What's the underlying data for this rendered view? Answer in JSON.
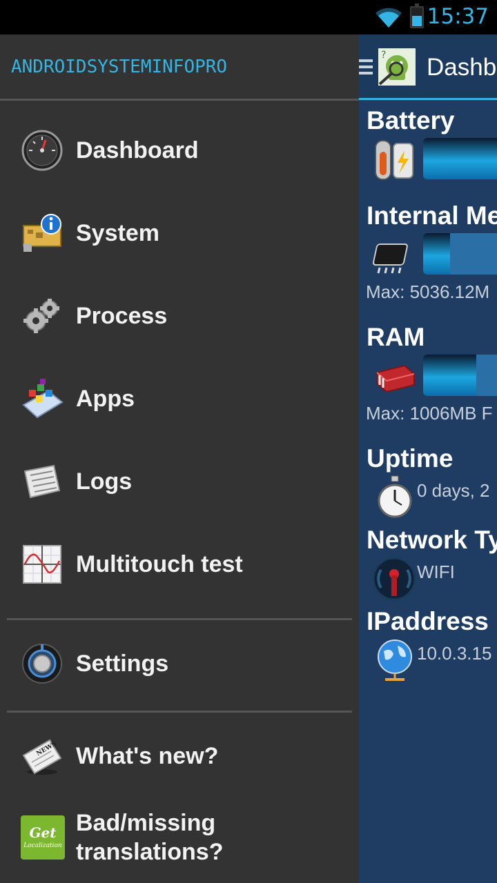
{
  "status_bar": {
    "time": "15:37",
    "wifi_icon": "wifi-icon",
    "battery_icon": "battery-icon"
  },
  "app": {
    "brand": "ANDROIDSYSTEMINFOPRO",
    "action_title": "Dashb"
  },
  "drawer": {
    "items": [
      {
        "label": "Dashboard",
        "icon": "gauge-icon"
      },
      {
        "label": "System",
        "icon": "system-info-icon"
      },
      {
        "label": "Process",
        "icon": "gears-icon"
      },
      {
        "label": "Apps",
        "icon": "apps-icon"
      },
      {
        "label": "Logs",
        "icon": "logs-icon"
      },
      {
        "label": "Multitouch test",
        "icon": "multitouch-graph-icon"
      }
    ],
    "settings": {
      "label": "Settings",
      "icon": "settings-knob-icon"
    },
    "whats_new": {
      "label": "What's new?",
      "icon": "newspaper-icon"
    },
    "translations": {
      "line1": "Bad/missing",
      "line2": "translations?",
      "icon": "get-localization-icon"
    }
  },
  "dashboard": {
    "battery": {
      "title": "Battery",
      "level": 1.0
    },
    "internal_memory": {
      "title": "Internal Me",
      "max": "Max: 5036.12M",
      "level": 0.28
    },
    "ram": {
      "title": "RAM",
      "max": "Max: 1006MB F",
      "level": 0.55
    },
    "uptime": {
      "title": "Uptime",
      "value": "0 days, 2"
    },
    "network_type": {
      "title": "Network Ty",
      "value": "WIFI"
    },
    "ip_address": {
      "title": "IPaddress",
      "value": "10.0.3.15"
    }
  },
  "colors": {
    "accent": "#33b5e5",
    "drawer_bg": "#333333",
    "content_bg": "#1f3d63"
  }
}
